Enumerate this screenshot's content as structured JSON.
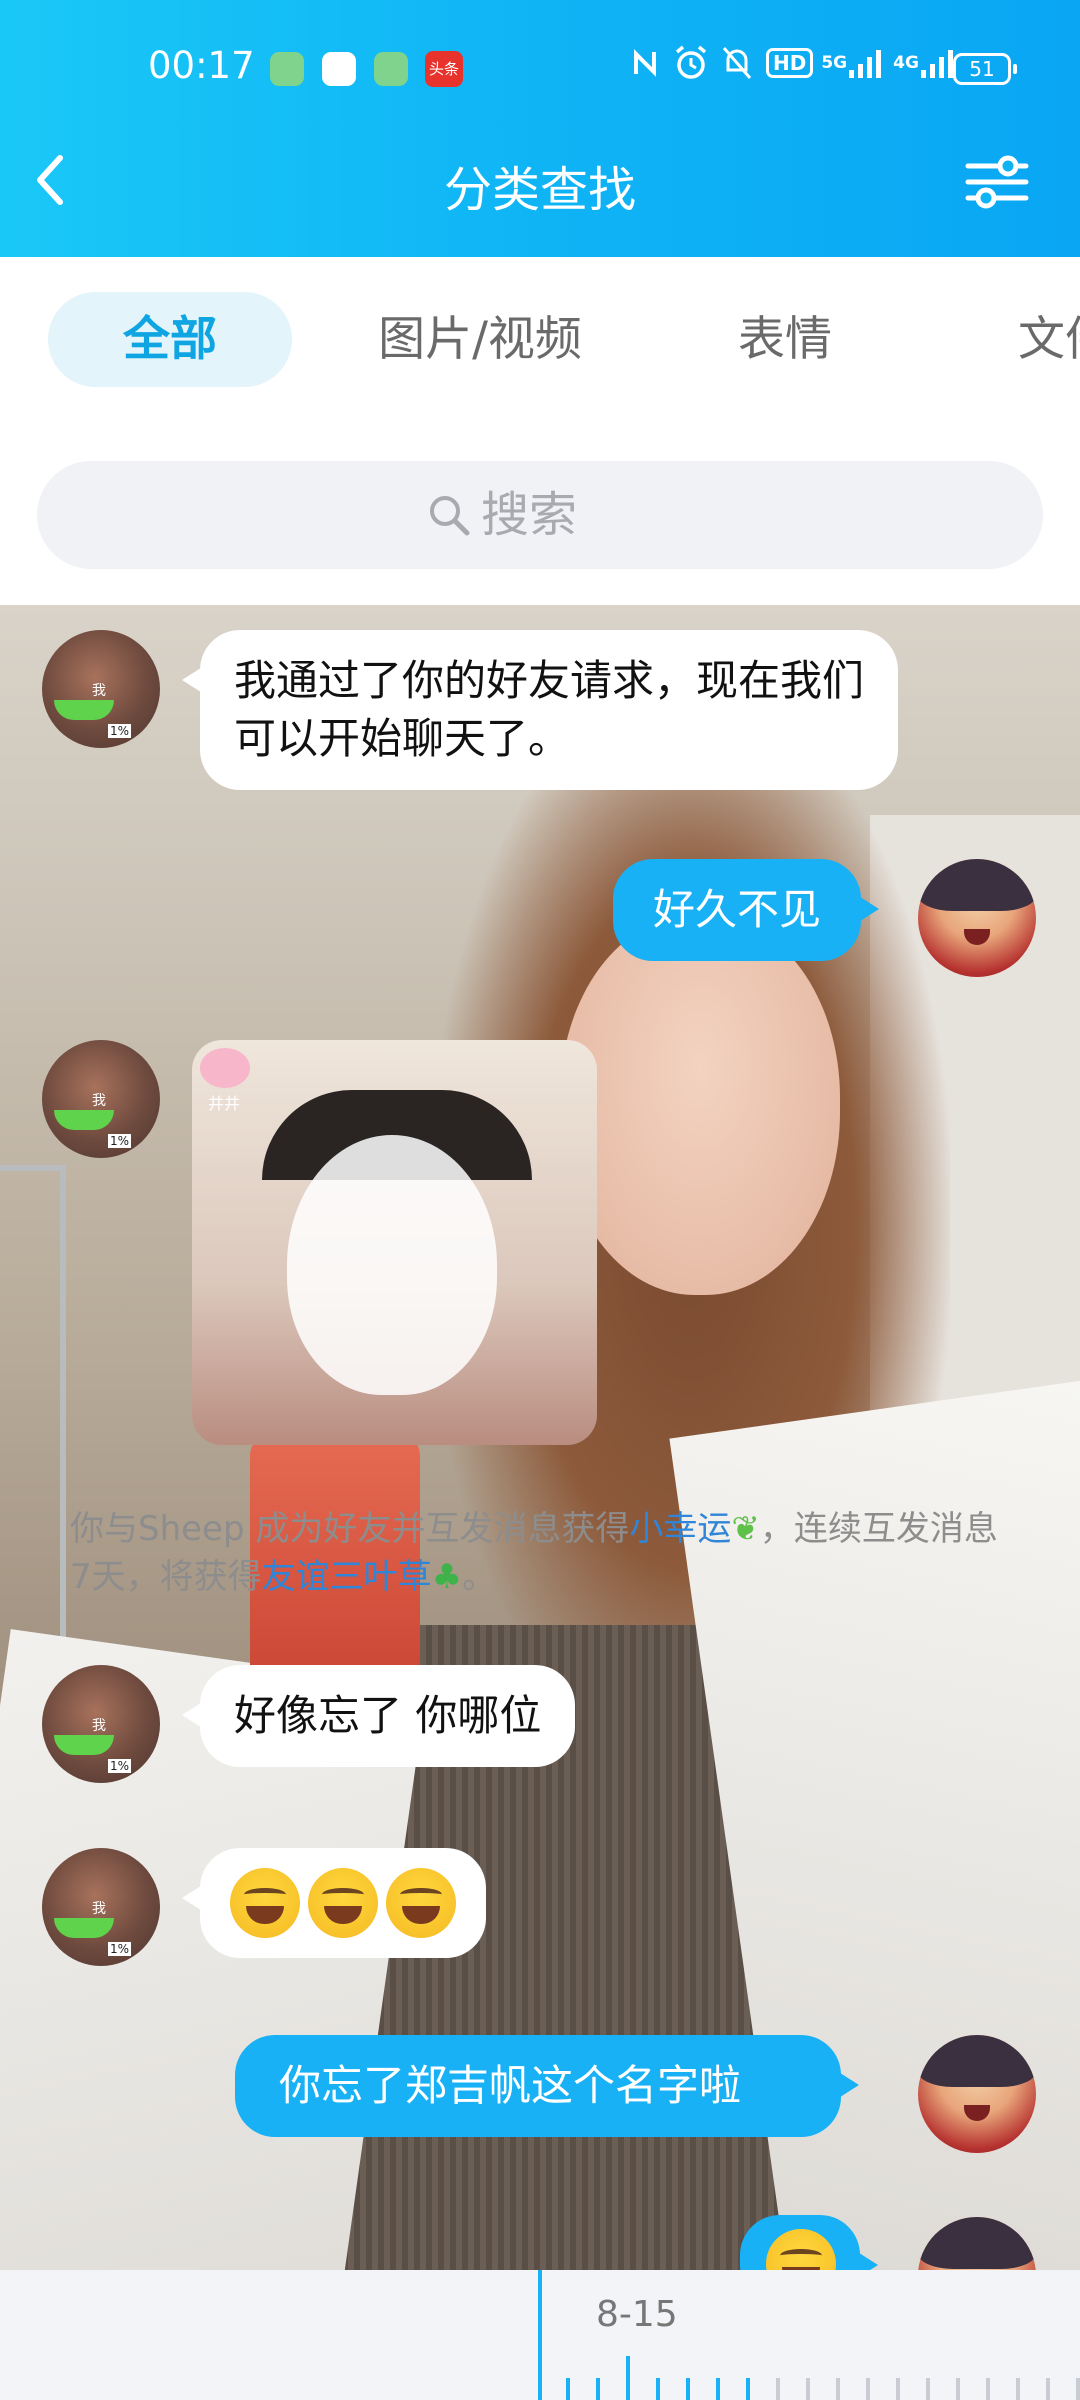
{
  "status_bar": {
    "time": "00:17",
    "network_5g": "5G",
    "network_4g": "4G",
    "hd_label": "HD",
    "battery": "51",
    "toutiao_label": "头条"
  },
  "nav": {
    "title": "分类查找"
  },
  "tabs": [
    {
      "label": "全部",
      "active": true
    },
    {
      "label": "图片/视频",
      "active": false
    },
    {
      "label": "表情",
      "active": false
    },
    {
      "label": "文件",
      "active": false
    }
  ],
  "search": {
    "placeholder": "搜索"
  },
  "messages": {
    "m1": "我通过了你的好友请求，现在我们可以开始聊天了。",
    "m2": "好久不见",
    "m4": "好像忘了 你哪位",
    "m6": "你忘了郑吉帆这个名字啦",
    "sticker_tag": "井井"
  },
  "avatar_labels": {
    "me_text": "我",
    "me_badge": "1%"
  },
  "system_message": {
    "prefix": "你与Sheep 成为好友并互发消息获得",
    "link1": "小幸运",
    "middle": "，连续互发消息7天，将获得",
    "link2": "友谊三叶草",
    "suffix": "。"
  },
  "timeline": {
    "date": "8-15"
  },
  "colors": {
    "header_blue": "#0fb4f5",
    "bubble_blue": "#18b1f5",
    "tab_active_text": "#0fa5e2",
    "link_blue": "#2f86d8"
  }
}
